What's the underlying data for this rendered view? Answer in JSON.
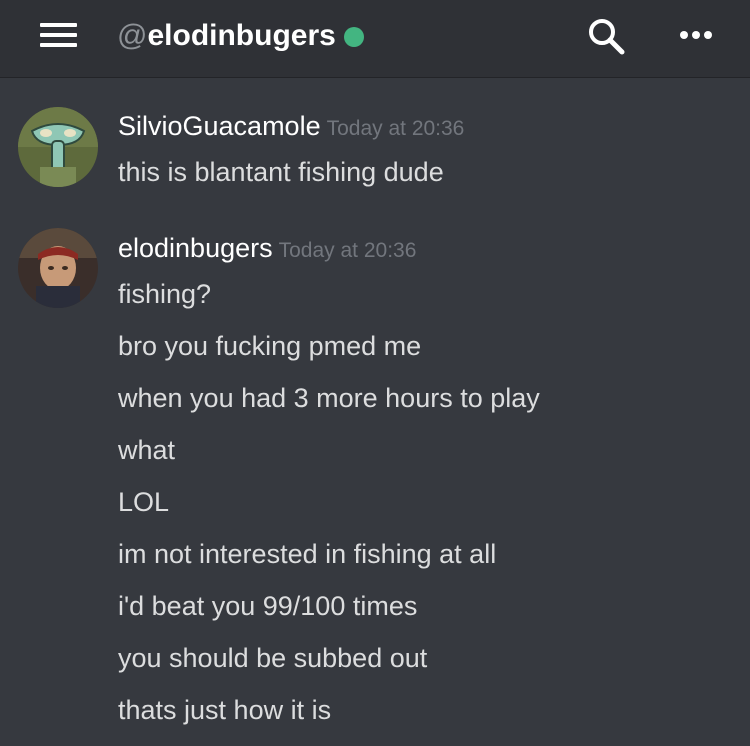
{
  "header": {
    "at_symbol": "@",
    "username": "elodinbugers",
    "status_color": "#43b581",
    "menu_icon": "hamburger-menu-icon",
    "search_icon": "search-icon",
    "more_icon": "more-options-icon"
  },
  "messages": [
    {
      "author": "SilvioGuacamole",
      "timestamp": "Today at 20:36",
      "avatar": "squidward-avatar",
      "lines": [
        "this is blantant fishing dude"
      ]
    },
    {
      "author": "elodinbugers",
      "timestamp": "Today at 20:36",
      "avatar": "user-photo-avatar",
      "lines": [
        "fishing?",
        "bro you fucking pmed me",
        "when you had 3 more hours to play",
        "what",
        "LOL",
        "im not interested in fishing at all",
        "i'd beat you 99/100 times",
        "you should be subbed out",
        "thats just how it is"
      ]
    }
  ]
}
